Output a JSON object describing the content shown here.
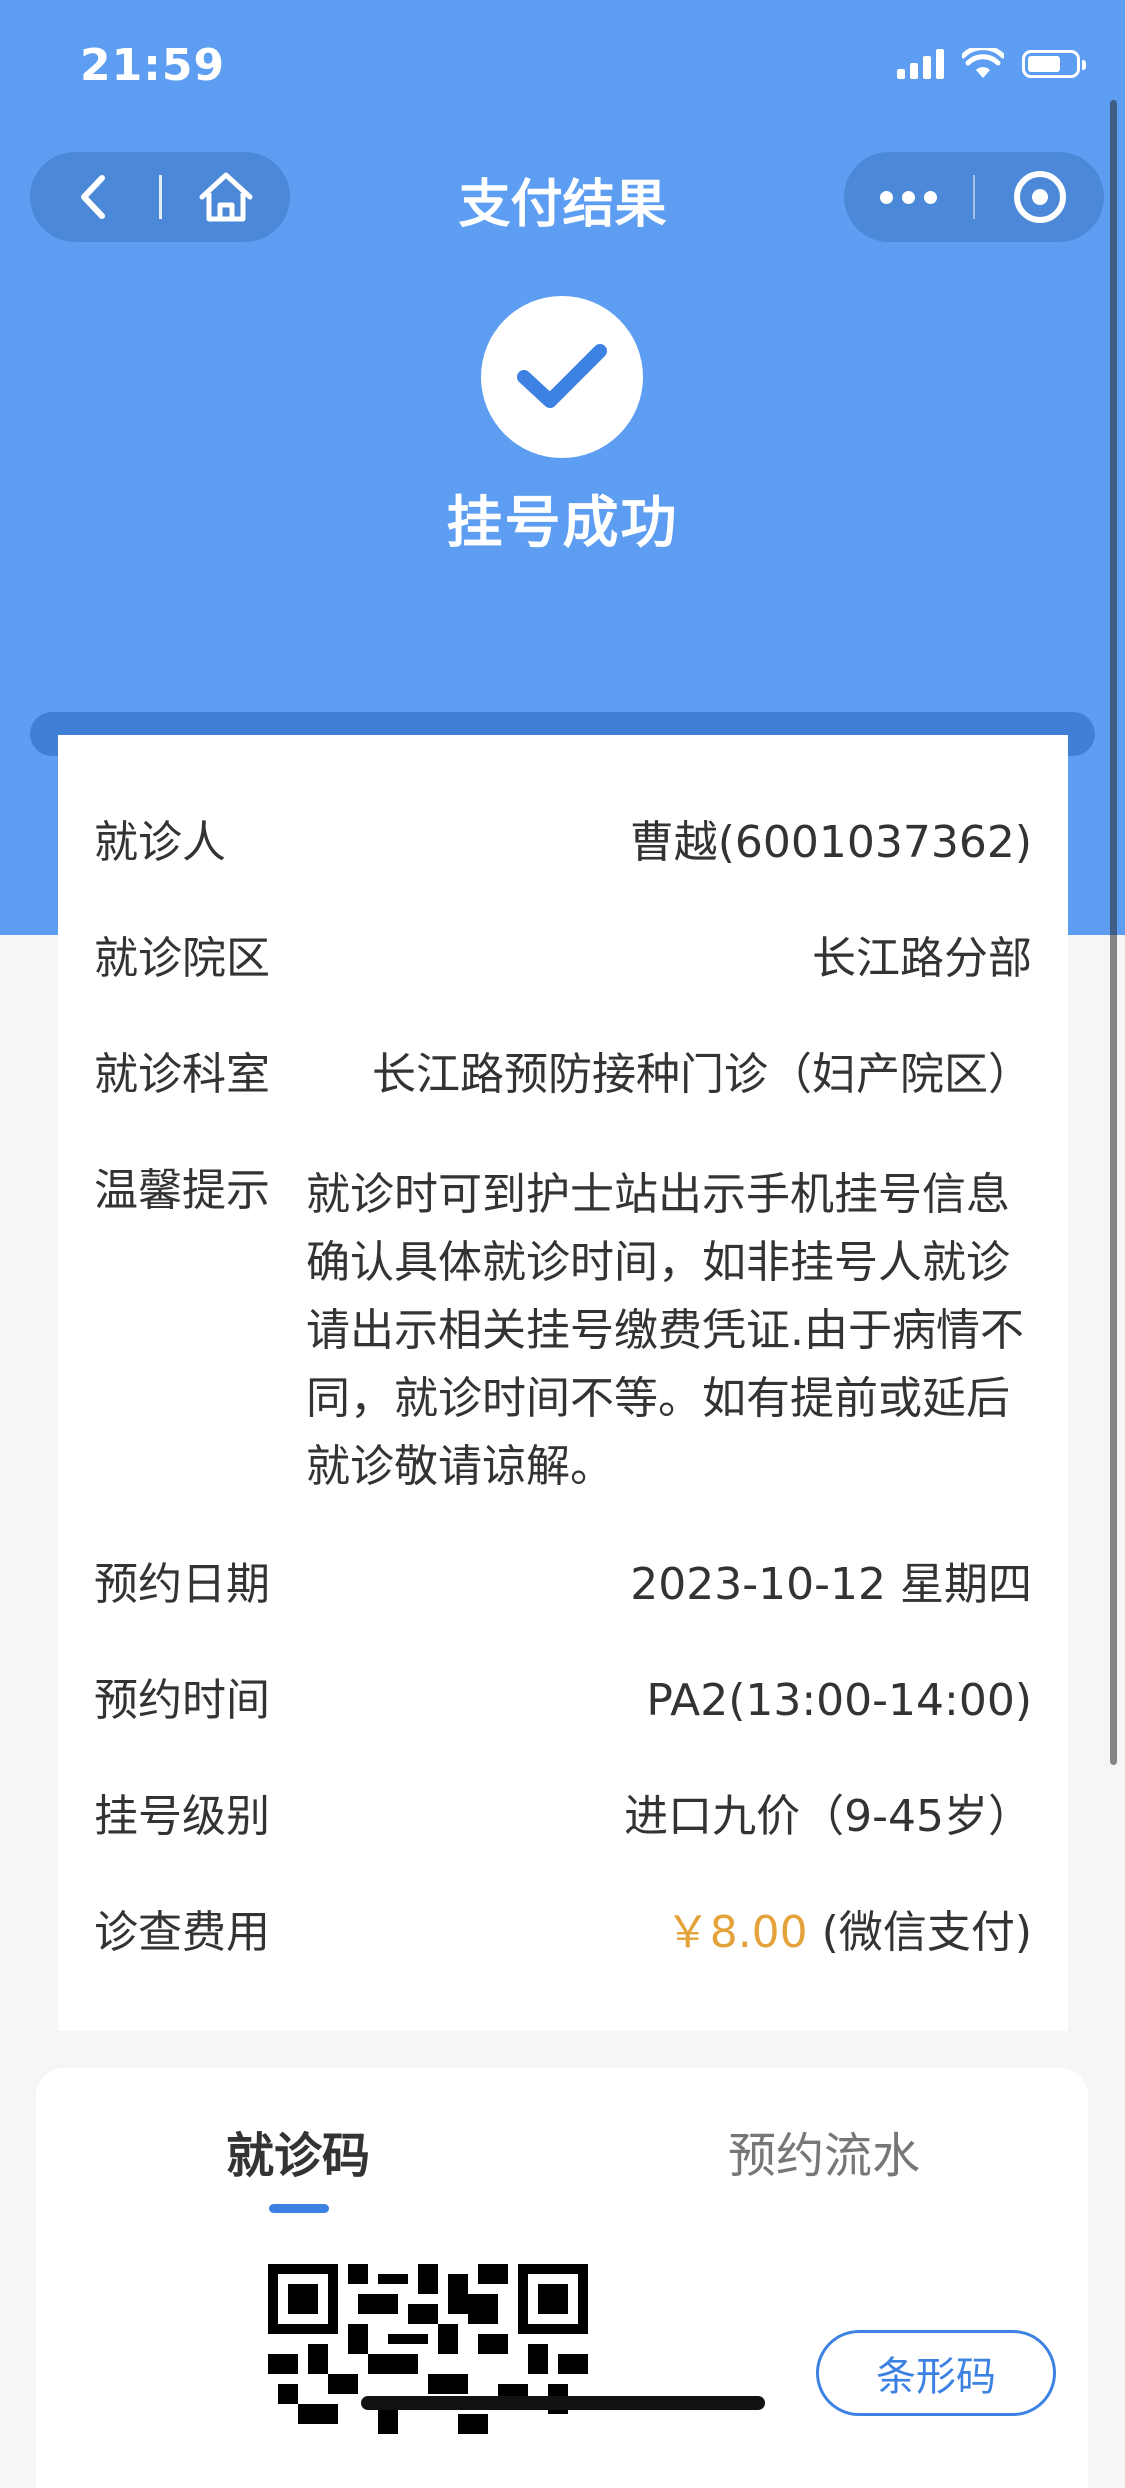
{
  "status_bar": {
    "time": "21:59"
  },
  "nav": {
    "title": "支付结果",
    "back_icon": "chevron-left-icon",
    "home_icon": "home-icon",
    "more_icon": "more-dots-icon",
    "close_icon": "target-circle-icon"
  },
  "success": {
    "icon": "checkmark-icon",
    "text": "挂号成功"
  },
  "details": {
    "patient": {
      "label": "就诊人",
      "value": "曹越(6001037362)"
    },
    "campus": {
      "label": "就诊院区",
      "value": "长江路分部"
    },
    "department": {
      "label": "就诊科室",
      "value": "长江路预防接种门诊（妇产院区）"
    },
    "tip": {
      "label": "温馨提示",
      "value": "就诊时可到护士站出示手机挂号信息确认具体就诊时间，如非挂号人就诊请出示相关挂号缴费凭证.由于病情不同，就诊时间不等。如有提前或延后就诊敬请谅解。"
    },
    "date": {
      "label": "预约日期",
      "value": "2023-10-12 星期四"
    },
    "time": {
      "label": "预约时间",
      "value": "PA2(13:00-14:00)"
    },
    "level": {
      "label": "挂号级别",
      "value": "进口九价（9-45岁）"
    },
    "fee": {
      "label": "诊查费用",
      "amount": "￥8.00",
      "method": " (微信支付)"
    }
  },
  "tabs": {
    "active": "就诊码",
    "inactive": "预约流水"
  },
  "barcode_button": "条形码",
  "colors": {
    "header_blue": "#5e9ef2",
    "accent_blue": "#3d82e3",
    "fee_orange": "#e3a33a"
  }
}
